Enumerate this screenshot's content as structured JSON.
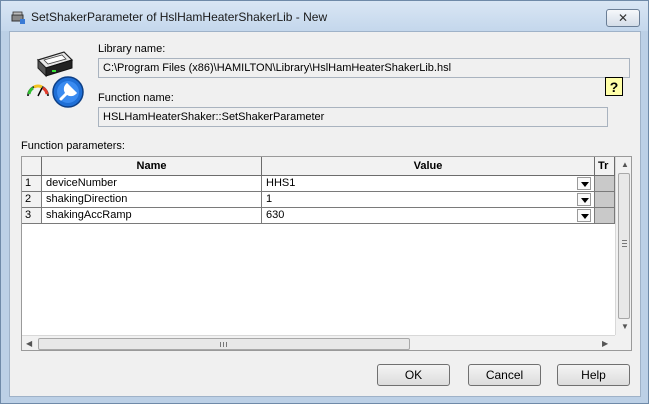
{
  "window": {
    "title": "SetShakerParameter of HslHamHeaterShakerLib - New",
    "close_glyph": "✕"
  },
  "library": {
    "label": "Library name:",
    "value": "C:\\Program Files (x86)\\HAMILTON\\Library\\HslHamHeaterShakerLib.hsl"
  },
  "function": {
    "label": "Function name:",
    "value": "HSLHamHeaterShaker::SetShakerParameter",
    "help_glyph": "?"
  },
  "parameters": {
    "label": "Function parameters:",
    "columns": {
      "name": "Name",
      "value": "Value",
      "tr": "Tr"
    },
    "rows": [
      {
        "num": "1",
        "name": "deviceNumber",
        "value": "HHS1"
      },
      {
        "num": "2",
        "name": "shakingDirection",
        "value": "1"
      },
      {
        "num": "3",
        "name": "shakingAccRamp",
        "value": "630"
      }
    ]
  },
  "buttons": {
    "ok": "OK",
    "cancel": "Cancel",
    "help": "Help"
  },
  "icons": [
    "shaker-device-icon",
    "gauge-icon",
    "wrench-icon",
    "help-icon",
    "dropdown-arrow-icon"
  ],
  "colors": {
    "titlebar": "#c4d7ec",
    "help_button": "#ffffa8",
    "wrench_blue": "#1f6fd6"
  }
}
